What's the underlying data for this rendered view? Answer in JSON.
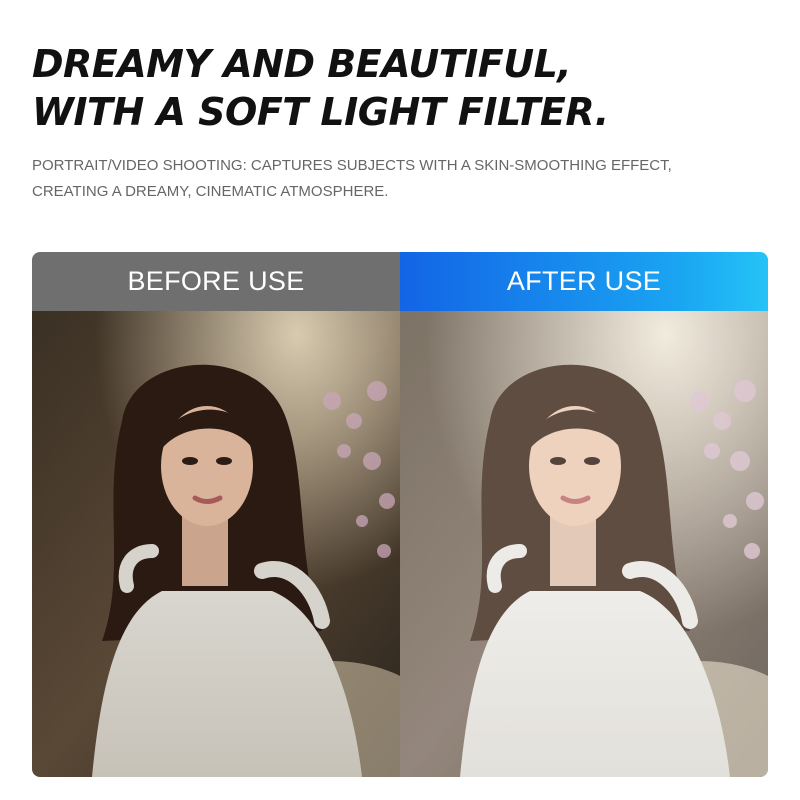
{
  "headline": {
    "line1": "DREAMY AND BEAUTIFUL,",
    "line2": "WITH A SOFT LIGHT FILTER."
  },
  "description": {
    "line1": "PORTRAIT/VIDEO SHOOTING: CAPTURES SUBJECTS WITH A SKIN-SMOOTHING EFFECT,",
    "line2": "CREATING A DREAMY, CINEMATIC ATMOSPHERE."
  },
  "comparison": {
    "before_label": "BEFORE USE",
    "after_label": "AFTER USE"
  },
  "colors": {
    "before_header": "#6f6f6f",
    "after_header_start": "#1364e6",
    "after_header_end": "#25c3f7"
  }
}
